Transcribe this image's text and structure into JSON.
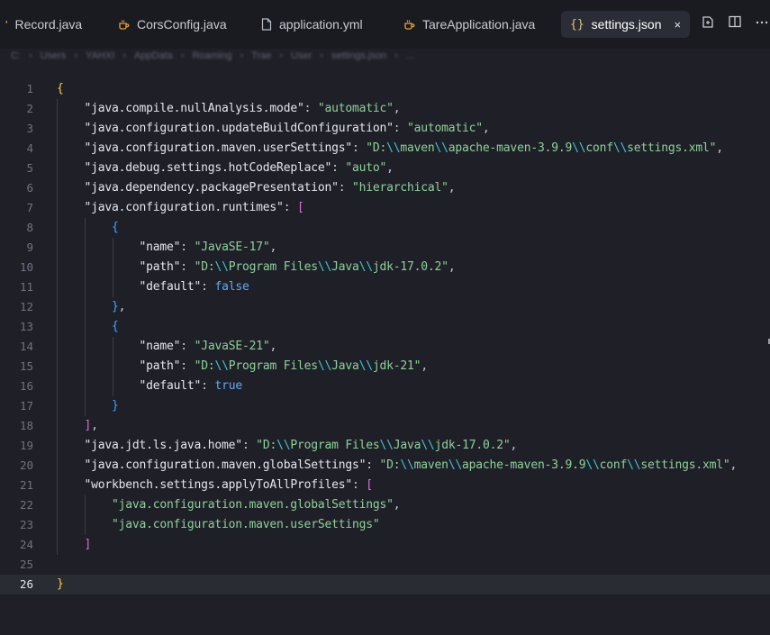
{
  "tabs": [
    {
      "label": "Record.java",
      "icon": "java-icon"
    },
    {
      "label": "CorsConfig.java",
      "icon": "java-icon"
    },
    {
      "label": "application.yml",
      "icon": "file-icon"
    },
    {
      "label": "TareApplication.java",
      "icon": "java-icon"
    },
    {
      "label": "settings.json",
      "icon": "json-icon",
      "active": true
    }
  ],
  "tab_glyphs": {
    "json": "{}",
    "close": "×"
  },
  "toolbar_icons": [
    "open-changes-icon",
    "split-editor-icon",
    "more-icon"
  ],
  "breadcrumb": [
    "C:",
    "Users",
    "YAHXI",
    "AppData",
    "Roaming",
    "Trae",
    "User",
    "settings.json",
    "..."
  ],
  "editor": {
    "current_line": 26,
    "lines": [
      {
        "n": "1",
        "tokens": [
          [
            "{",
            "br1"
          ]
        ]
      },
      {
        "n": "2",
        "tokens": [
          [
            "    ",
            ""
          ],
          [
            "\"java.compile.nullAnalysis.mode\"",
            "k"
          ],
          [
            ": ",
            "p"
          ],
          [
            "\"automatic\"",
            "s"
          ],
          [
            ",",
            "p"
          ]
        ]
      },
      {
        "n": "3",
        "tokens": [
          [
            "    ",
            ""
          ],
          [
            "\"java.configuration.updateBuildConfiguration\"",
            "k"
          ],
          [
            ": ",
            "p"
          ],
          [
            "\"automatic\"",
            "s"
          ],
          [
            ",",
            "p"
          ]
        ]
      },
      {
        "n": "4",
        "tokens": [
          [
            "    ",
            ""
          ],
          [
            "\"java.configuration.maven.userSettings\"",
            "k"
          ],
          [
            ": ",
            "p"
          ],
          [
            "\"D:",
            "s"
          ],
          [
            "\\\\",
            "esc"
          ],
          [
            "maven",
            "s"
          ],
          [
            "\\\\",
            "esc"
          ],
          [
            "apache-maven-3.9.9",
            "s"
          ],
          [
            "\\\\",
            "esc"
          ],
          [
            "conf",
            "s"
          ],
          [
            "\\\\",
            "esc"
          ],
          [
            "settings.xml\"",
            "s"
          ],
          [
            ",",
            "p"
          ]
        ]
      },
      {
        "n": "5",
        "tokens": [
          [
            "    ",
            ""
          ],
          [
            "\"java.debug.settings.hotCodeReplace\"",
            "k"
          ],
          [
            ": ",
            "p"
          ],
          [
            "\"auto\"",
            "s"
          ],
          [
            ",",
            "p"
          ]
        ]
      },
      {
        "n": "6",
        "tokens": [
          [
            "    ",
            ""
          ],
          [
            "\"java.dependency.packagePresentation\"",
            "k"
          ],
          [
            ": ",
            "p"
          ],
          [
            "\"hierarchical\"",
            "s"
          ],
          [
            ",",
            "p"
          ]
        ]
      },
      {
        "n": "7",
        "tokens": [
          [
            "    ",
            ""
          ],
          [
            "\"java.configuration.runtimes\"",
            "k"
          ],
          [
            ": ",
            "p"
          ],
          [
            "[",
            "br2"
          ]
        ]
      },
      {
        "n": "8",
        "tokens": [
          [
            "        ",
            ""
          ],
          [
            "{",
            "br3"
          ]
        ]
      },
      {
        "n": "9",
        "tokens": [
          [
            "            ",
            ""
          ],
          [
            "\"name\"",
            "k"
          ],
          [
            ": ",
            "p"
          ],
          [
            "\"JavaSE-17\"",
            "s"
          ],
          [
            ",",
            "p"
          ]
        ]
      },
      {
        "n": "10",
        "tokens": [
          [
            "            ",
            ""
          ],
          [
            "\"path\"",
            "k"
          ],
          [
            ": ",
            "p"
          ],
          [
            "\"D:",
            "s"
          ],
          [
            "\\\\",
            "esc"
          ],
          [
            "Program Files",
            "s"
          ],
          [
            "\\\\",
            "esc"
          ],
          [
            "Java",
            "s"
          ],
          [
            "\\\\",
            "esc"
          ],
          [
            "jdk-17.0.2\"",
            "s"
          ],
          [
            ",",
            "p"
          ]
        ]
      },
      {
        "n": "11",
        "tokens": [
          [
            "            ",
            ""
          ],
          [
            "\"default\"",
            "k"
          ],
          [
            ": ",
            "p"
          ],
          [
            "false",
            "kw"
          ]
        ]
      },
      {
        "n": "12",
        "tokens": [
          [
            "        ",
            ""
          ],
          [
            "}",
            "br3"
          ],
          [
            ",",
            "p"
          ]
        ]
      },
      {
        "n": "13",
        "tokens": [
          [
            "        ",
            ""
          ],
          [
            "{",
            "br3"
          ]
        ]
      },
      {
        "n": "14",
        "tokens": [
          [
            "            ",
            ""
          ],
          [
            "\"name\"",
            "k"
          ],
          [
            ": ",
            "p"
          ],
          [
            "\"JavaSE-21\"",
            "s"
          ],
          [
            ",",
            "p"
          ]
        ]
      },
      {
        "n": "15",
        "tokens": [
          [
            "            ",
            ""
          ],
          [
            "\"path\"",
            "k"
          ],
          [
            ": ",
            "p"
          ],
          [
            "\"D:",
            "s"
          ],
          [
            "\\\\",
            "esc"
          ],
          [
            "Program Files",
            "s"
          ],
          [
            "\\\\",
            "esc"
          ],
          [
            "Java",
            "s"
          ],
          [
            "\\\\",
            "esc"
          ],
          [
            "jdk-21\"",
            "s"
          ],
          [
            ",",
            "p"
          ]
        ]
      },
      {
        "n": "16",
        "tokens": [
          [
            "            ",
            ""
          ],
          [
            "\"default\"",
            "k"
          ],
          [
            ": ",
            "p"
          ],
          [
            "true",
            "kw"
          ]
        ]
      },
      {
        "n": "17",
        "tokens": [
          [
            "        ",
            ""
          ],
          [
            "}",
            "br3"
          ]
        ]
      },
      {
        "n": "18",
        "tokens": [
          [
            "    ",
            ""
          ],
          [
            "]",
            "br2"
          ],
          [
            ",",
            "p"
          ]
        ]
      },
      {
        "n": "19",
        "tokens": [
          [
            "    ",
            ""
          ],
          [
            "\"java.jdt.ls.java.home\"",
            "k"
          ],
          [
            ": ",
            "p"
          ],
          [
            "\"D:",
            "s"
          ],
          [
            "\\\\",
            "esc"
          ],
          [
            "Program Files",
            "s"
          ],
          [
            "\\\\",
            "esc"
          ],
          [
            "Java",
            "s"
          ],
          [
            "\\\\",
            "esc"
          ],
          [
            "jdk-17.0.2\"",
            "s"
          ],
          [
            ",",
            "p"
          ]
        ]
      },
      {
        "n": "20",
        "tokens": [
          [
            "    ",
            ""
          ],
          [
            "\"java.configuration.maven.globalSettings\"",
            "k"
          ],
          [
            ": ",
            "p"
          ],
          [
            "\"D:",
            "s"
          ],
          [
            "\\\\",
            "esc"
          ],
          [
            "maven",
            "s"
          ],
          [
            "\\\\",
            "esc"
          ],
          [
            "apache-maven-3.9.9",
            "s"
          ],
          [
            "\\\\",
            "esc"
          ],
          [
            "conf",
            "s"
          ],
          [
            "\\\\",
            "esc"
          ],
          [
            "settings.xml\"",
            "s"
          ],
          [
            ",",
            "p"
          ]
        ]
      },
      {
        "n": "21",
        "tokens": [
          [
            "    ",
            ""
          ],
          [
            "\"workbench.settings.applyToAllProfiles\"",
            "k"
          ],
          [
            ": ",
            "p"
          ],
          [
            "[",
            "br2"
          ]
        ]
      },
      {
        "n": "22",
        "tokens": [
          [
            "        ",
            ""
          ],
          [
            "\"java.configuration.maven.globalSettings\"",
            "s"
          ],
          [
            ",",
            "p"
          ]
        ]
      },
      {
        "n": "23",
        "tokens": [
          [
            "        ",
            ""
          ],
          [
            "\"java.configuration.maven.userSettings\"",
            "s"
          ]
        ]
      },
      {
        "n": "24",
        "tokens": [
          [
            "    ",
            ""
          ],
          [
            "]",
            "br2"
          ]
        ]
      },
      {
        "n": "25",
        "tokens": []
      },
      {
        "n": "26",
        "tokens": [
          [
            "}",
            "br1"
          ]
        ]
      }
    ]
  }
}
